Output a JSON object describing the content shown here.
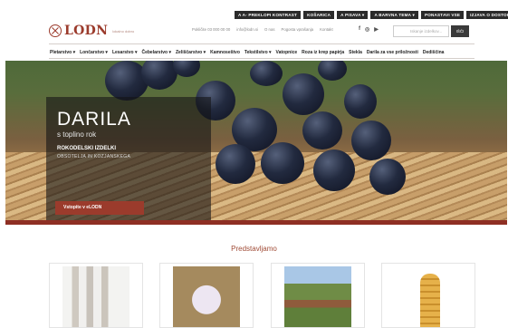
{
  "utility_bar": [
    "A  A- PREKLOPI KONTRAST",
    "KOŠARICA",
    "A PISAVA ▾",
    "A BARVNA TEMA ▾",
    "PONASTAVI VSE",
    "IZJAVA O DOSTOPNOSTI"
  ],
  "header": {
    "logo_text": "LODN",
    "logo_sub": "lokalno dobro",
    "contact": [
      "Pokličite 03 000 00 00",
      "info@lodn.si",
      "O nas",
      "Pogosta vprašanja",
      "Kontakt"
    ],
    "search_placeholder": "Iskanje izdelkov...",
    "search_button": "IŠČI"
  },
  "nav": [
    "Pletarstvo ▾",
    "Lončarstvo ▾",
    "Lesarstvo ▾",
    "Čebelarstvo ▾",
    "Zeliščarstvo ▾",
    "Kamnoseštvo",
    "Tekstilstvo ▾",
    "Vatopnice",
    "Roza iz krep papirja",
    "Stekla",
    "Darila za vse priložnosti",
    "Dediščina"
  ],
  "hero": {
    "title": "DARILA",
    "subtitle": "s toplino rok",
    "line1": "ROKODELSKI IZDELKI",
    "line2": "OBSOTELJA IN KOZJANSKEGA",
    "button": "Vstopite v eLODN"
  },
  "section_title": "Predstavljamo",
  "colors": {
    "brand": "#9b3b2c",
    "dark": "#2b2b2b"
  },
  "icons": [
    "facebook-icon",
    "instagram-icon",
    "youtube-icon",
    "search-icon"
  ]
}
